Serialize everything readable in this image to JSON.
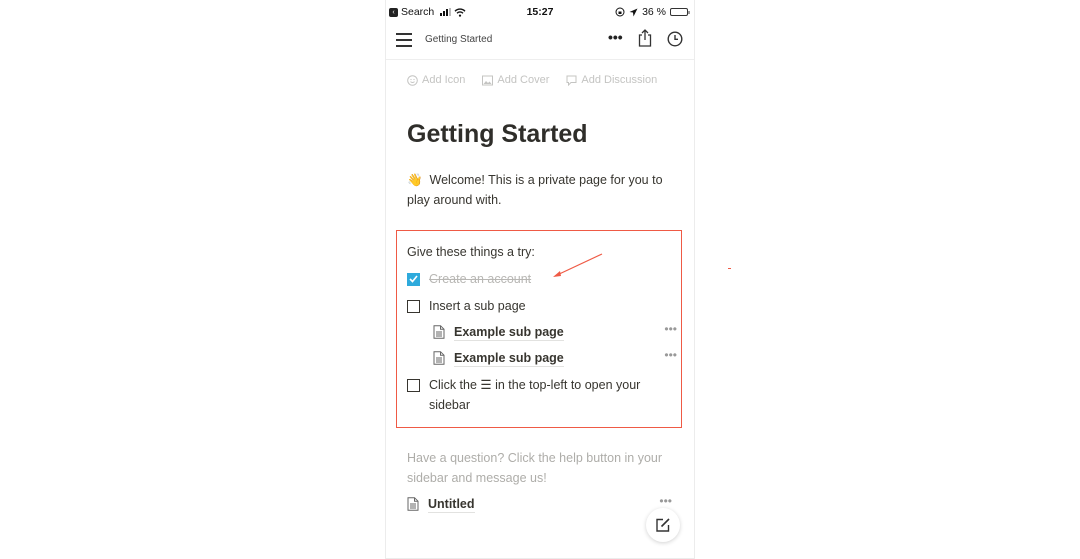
{
  "status_bar": {
    "back_app": "Search",
    "time": "15:27",
    "battery_text": "36 %",
    "battery_level": 0.36
  },
  "navbar": {
    "title": "Getting Started",
    "icons": [
      "hamburger-menu-icon",
      "more-dots-icon",
      "share-icon",
      "clock-history-icon"
    ],
    "more_label": "•••"
  },
  "page_actions": [
    {
      "icon": "smiley-icon",
      "label": "Add Icon"
    },
    {
      "icon": "image-icon",
      "label": "Add Cover"
    },
    {
      "icon": "comment-icon",
      "label": "Add Discussion"
    }
  ],
  "page": {
    "title": "Getting Started",
    "welcome_emoji": "👋",
    "welcome_text": "Welcome! This is a private page for you to play around with.",
    "try_heading": "Give these things a try:",
    "todos": [
      {
        "label": "Create an account",
        "checked": true
      },
      {
        "label": "Insert a sub page",
        "checked": false
      },
      {
        "label": "Click the ☰ in the top-left to open your sidebar",
        "checked": false
      }
    ],
    "subpages": [
      {
        "label": "Example sub page",
        "more": "•••"
      },
      {
        "label": "Example sub page",
        "more": "•••"
      }
    ],
    "help_text": "Have a question? Click the help button in your sidebar and message us!",
    "untitled": {
      "label": "Untitled",
      "more": "•••"
    }
  },
  "colors": {
    "annotation_red": "#ef5a45",
    "checkbox_blue": "#2eaadc",
    "text": "#37352f",
    "muted": "#aeada9"
  }
}
